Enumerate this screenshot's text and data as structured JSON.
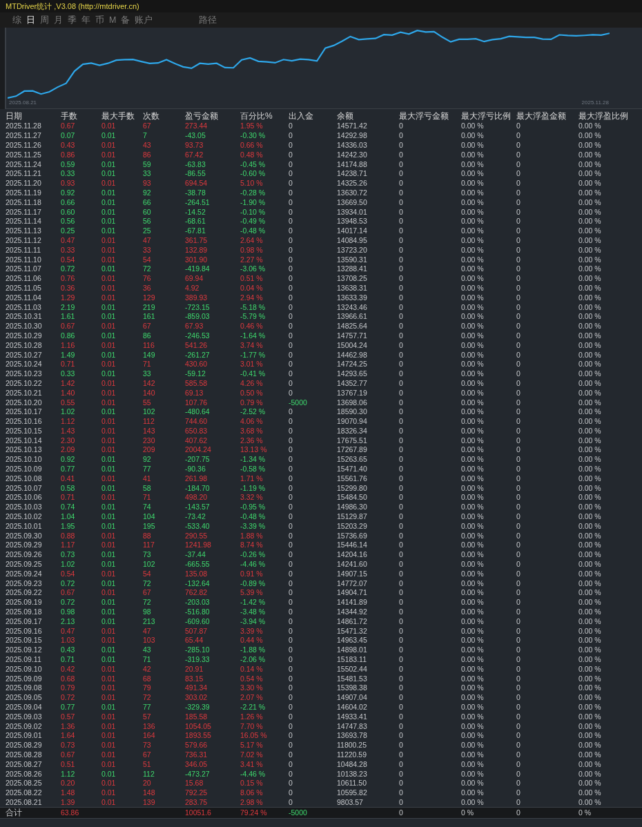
{
  "window": {
    "title": "MTDriver统计 ,V3.08 (http://mtdriver.cn)"
  },
  "tabs": [
    {
      "label": "综",
      "selected": false
    },
    {
      "label": "日",
      "selected": true
    },
    {
      "label": "周",
      "selected": false
    },
    {
      "label": "月",
      "selected": false
    },
    {
      "label": "季",
      "selected": false
    },
    {
      "label": "年",
      "selected": false
    },
    {
      "label": "币",
      "selected": false
    },
    {
      "label": "M",
      "selected": false
    },
    {
      "label": "备",
      "selected": false
    },
    {
      "label": "账户",
      "selected": false
    },
    {
      "label": "路径",
      "selected": false
    }
  ],
  "chart": {
    "start_label": "2025.08.21",
    "end_label": "2025.11.28"
  },
  "table": {
    "columns": [
      "日期",
      "手数",
      "最大手数",
      "次数",
      "盈亏金额",
      "百分比%",
      "出入金",
      "余额",
      "最大浮亏金额",
      "最大浮亏比例",
      "最大浮盈金额",
      "最大浮盈比例"
    ],
    "rows": [
      {
        "profit": true,
        "outflow": false,
        "cells": [
          "2025.11.28",
          "0.67",
          "0.01",
          "67",
          "273.44",
          "1.95 %",
          "0",
          "14571.42",
          "0",
          "0.00 %",
          "0",
          "0.00 %"
        ]
      },
      {
        "profit": false,
        "outflow": false,
        "cells": [
          "2025.11.27",
          "0.07",
          "0.01",
          "7",
          "-43.05",
          "-0.30 %",
          "0",
          "14292.98",
          "0",
          "0.00 %",
          "0",
          "0.00 %"
        ]
      },
      {
        "profit": true,
        "outflow": false,
        "cells": [
          "2025.11.26",
          "0.43",
          "0.01",
          "43",
          "93.73",
          "0.66 %",
          "0",
          "14336.03",
          "0",
          "0.00 %",
          "0",
          "0.00 %"
        ]
      },
      {
        "profit": true,
        "outflow": false,
        "cells": [
          "2025.11.25",
          "0.86",
          "0.01",
          "86",
          "67.42",
          "0.48 %",
          "0",
          "14242.30",
          "0",
          "0.00 %",
          "0",
          "0.00 %"
        ]
      },
      {
        "profit": false,
        "outflow": false,
        "cells": [
          "2025.11.24",
          "0.59",
          "0.01",
          "59",
          "-63.83",
          "-0.45 %",
          "0",
          "14174.88",
          "0",
          "0.00 %",
          "0",
          "0.00 %"
        ]
      },
      {
        "profit": false,
        "outflow": false,
        "cells": [
          "2025.11.21",
          "0.33",
          "0.01",
          "33",
          "-86.55",
          "-0.60 %",
          "0",
          "14238.71",
          "0",
          "0.00 %",
          "0",
          "0.00 %"
        ]
      },
      {
        "profit": true,
        "outflow": false,
        "cells": [
          "2025.11.20",
          "0.93",
          "0.01",
          "93",
          "694.54",
          "5.10 %",
          "0",
          "14325.26",
          "0",
          "0.00 %",
          "0",
          "0.00 %"
        ]
      },
      {
        "profit": false,
        "outflow": false,
        "cells": [
          "2025.11.19",
          "0.92",
          "0.01",
          "92",
          "-38.78",
          "-0.28 %",
          "0",
          "13630.72",
          "0",
          "0.00 %",
          "0",
          "0.00 %"
        ]
      },
      {
        "profit": false,
        "outflow": false,
        "cells": [
          "2025.11.18",
          "0.66",
          "0.01",
          "66",
          "-264.51",
          "-1.90 %",
          "0",
          "13669.50",
          "0",
          "0.00 %",
          "0",
          "0.00 %"
        ]
      },
      {
        "profit": false,
        "outflow": false,
        "cells": [
          "2025.11.17",
          "0.60",
          "0.01",
          "60",
          "-14.52",
          "-0.10 %",
          "0",
          "13934.01",
          "0",
          "0.00 %",
          "0",
          "0.00 %"
        ]
      },
      {
        "profit": false,
        "outflow": false,
        "cells": [
          "2025.11.14",
          "0.56",
          "0.01",
          "56",
          "-68.61",
          "-0.49 %",
          "0",
          "13948.53",
          "0",
          "0.00 %",
          "0",
          "0.00 %"
        ]
      },
      {
        "profit": false,
        "outflow": false,
        "cells": [
          "2025.11.13",
          "0.25",
          "0.01",
          "25",
          "-67.81",
          "-0.48 %",
          "0",
          "14017.14",
          "0",
          "0.00 %",
          "0",
          "0.00 %"
        ]
      },
      {
        "profit": true,
        "outflow": false,
        "cells": [
          "2025.11.12",
          "0.47",
          "0.01",
          "47",
          "361.75",
          "2.64 %",
          "0",
          "14084.95",
          "0",
          "0.00 %",
          "0",
          "0.00 %"
        ]
      },
      {
        "profit": true,
        "outflow": false,
        "cells": [
          "2025.11.11",
          "0.33",
          "0.01",
          "33",
          "132.89",
          "0.98 %",
          "0",
          "13723.20",
          "0",
          "0.00 %",
          "0",
          "0.00 %"
        ]
      },
      {
        "profit": true,
        "outflow": false,
        "cells": [
          "2025.11.10",
          "0.54",
          "0.01",
          "54",
          "301.90",
          "2.27 %",
          "0",
          "13590.31",
          "0",
          "0.00 %",
          "0",
          "0.00 %"
        ]
      },
      {
        "profit": false,
        "outflow": false,
        "cells": [
          "2025.11.07",
          "0.72",
          "0.01",
          "72",
          "-419.84",
          "-3.06 %",
          "0",
          "13288.41",
          "0",
          "0.00 %",
          "0",
          "0.00 %"
        ]
      },
      {
        "profit": true,
        "outflow": false,
        "cells": [
          "2025.11.06",
          "0.76",
          "0.01",
          "76",
          "69.94",
          "0.51 %",
          "0",
          "13708.25",
          "0",
          "0.00 %",
          "0",
          "0.00 %"
        ]
      },
      {
        "profit": true,
        "outflow": false,
        "cells": [
          "2025.11.05",
          "0.36",
          "0.01",
          "36",
          "4.92",
          "0.04 %",
          "0",
          "13638.31",
          "0",
          "0.00 %",
          "0",
          "0.00 %"
        ]
      },
      {
        "profit": true,
        "outflow": false,
        "cells": [
          "2025.11.04",
          "1.29",
          "0.01",
          "129",
          "389.93",
          "2.94 %",
          "0",
          "13633.39",
          "0",
          "0.00 %",
          "0",
          "0.00 %"
        ]
      },
      {
        "profit": false,
        "outflow": false,
        "cells": [
          "2025.11.03",
          "2.19",
          "0.01",
          "219",
          "-723.15",
          "-5.18 %",
          "0",
          "13243.46",
          "0",
          "0.00 %",
          "0",
          "0.00 %"
        ]
      },
      {
        "profit": false,
        "outflow": false,
        "cells": [
          "2025.10.31",
          "1.61",
          "0.01",
          "161",
          "-859.03",
          "-5.79 %",
          "0",
          "13966.61",
          "0",
          "0.00 %",
          "0",
          "0.00 %"
        ]
      },
      {
        "profit": true,
        "outflow": false,
        "cells": [
          "2025.10.30",
          "0.67",
          "0.01",
          "67",
          "67.93",
          "0.46 %",
          "0",
          "14825.64",
          "0",
          "0.00 %",
          "0",
          "0.00 %"
        ]
      },
      {
        "profit": false,
        "outflow": false,
        "cells": [
          "2025.10.29",
          "0.86",
          "0.01",
          "86",
          "-246.53",
          "-1.64 %",
          "0",
          "14757.71",
          "0",
          "0.00 %",
          "0",
          "0.00 %"
        ]
      },
      {
        "profit": true,
        "outflow": false,
        "cells": [
          "2025.10.28",
          "1.16",
          "0.01",
          "116",
          "541.26",
          "3.74 %",
          "0",
          "15004.24",
          "0",
          "0.00 %",
          "0",
          "0.00 %"
        ]
      },
      {
        "profit": false,
        "outflow": false,
        "cells": [
          "2025.10.27",
          "1.49",
          "0.01",
          "149",
          "-261.27",
          "-1.77 %",
          "0",
          "14462.98",
          "0",
          "0.00 %",
          "0",
          "0.00 %"
        ]
      },
      {
        "profit": true,
        "outflow": false,
        "cells": [
          "2025.10.24",
          "0.71",
          "0.01",
          "71",
          "430.60",
          "3.01 %",
          "0",
          "14724.25",
          "0",
          "0.00 %",
          "0",
          "0.00 %"
        ]
      },
      {
        "profit": false,
        "outflow": false,
        "cells": [
          "2025.10.23",
          "0.33",
          "0.01",
          "33",
          "-59.12",
          "-0.41 %",
          "0",
          "14293.65",
          "0",
          "0.00 %",
          "0",
          "0.00 %"
        ]
      },
      {
        "profit": true,
        "outflow": false,
        "cells": [
          "2025.10.22",
          "1.42",
          "0.01",
          "142",
          "585.58",
          "4.26 %",
          "0",
          "14352.77",
          "0",
          "0.00 %",
          "0",
          "0.00 %"
        ]
      },
      {
        "profit": true,
        "outflow": false,
        "cells": [
          "2025.10.21",
          "1.40",
          "0.01",
          "140",
          "69.13",
          "0.50 %",
          "0",
          "13767.19",
          "0",
          "0.00 %",
          "0",
          "0.00 %"
        ]
      },
      {
        "profit": true,
        "outflow": true,
        "cells": [
          "2025.10.20",
          "0.55",
          "0.01",
          "55",
          "107.76",
          "0.79 %",
          "-5000",
          "13698.06",
          "0",
          "0.00 %",
          "0",
          "0.00 %"
        ]
      },
      {
        "profit": false,
        "outflow": false,
        "cells": [
          "2025.10.17",
          "1.02",
          "0.01",
          "102",
          "-480.64",
          "-2.52 %",
          "0",
          "18590.30",
          "0",
          "0.00 %",
          "0",
          "0.00 %"
        ]
      },
      {
        "profit": true,
        "outflow": false,
        "cells": [
          "2025.10.16",
          "1.12",
          "0.01",
          "112",
          "744.60",
          "4.06 %",
          "0",
          "19070.94",
          "0",
          "0.00 %",
          "0",
          "0.00 %"
        ]
      },
      {
        "profit": true,
        "outflow": false,
        "cells": [
          "2025.10.15",
          "1.43",
          "0.01",
          "143",
          "650.83",
          "3.68 %",
          "0",
          "18326.34",
          "0",
          "0.00 %",
          "0",
          "0.00 %"
        ]
      },
      {
        "profit": true,
        "outflow": false,
        "cells": [
          "2025.10.14",
          "2.30",
          "0.01",
          "230",
          "407.62",
          "2.36 %",
          "0",
          "17675.51",
          "0",
          "0.00 %",
          "0",
          "0.00 %"
        ]
      },
      {
        "profit": true,
        "outflow": false,
        "cells": [
          "2025.10.13",
          "2.09",
          "0.01",
          "209",
          "2004.24",
          "13.13 %",
          "0",
          "17267.89",
          "0",
          "0.00 %",
          "0",
          "0.00 %"
        ]
      },
      {
        "profit": false,
        "outflow": false,
        "cells": [
          "2025.10.10",
          "0.92",
          "0.01",
          "92",
          "-207.75",
          "-1.34 %",
          "0",
          "15263.65",
          "0",
          "0.00 %",
          "0",
          "0.00 %"
        ]
      },
      {
        "profit": false,
        "outflow": false,
        "cells": [
          "2025.10.09",
          "0.77",
          "0.01",
          "77",
          "-90.36",
          "-0.58 %",
          "0",
          "15471.40",
          "0",
          "0.00 %",
          "0",
          "0.00 %"
        ]
      },
      {
        "profit": true,
        "outflow": false,
        "cells": [
          "2025.10.08",
          "0.41",
          "0.01",
          "41",
          "261.98",
          "1.71 %",
          "0",
          "15561.76",
          "0",
          "0.00 %",
          "0",
          "0.00 %"
        ]
      },
      {
        "profit": false,
        "outflow": false,
        "cells": [
          "2025.10.07",
          "0.58",
          "0.01",
          "58",
          "-184.70",
          "-1.19 %",
          "0",
          "15299.80",
          "0",
          "0.00 %",
          "0",
          "0.00 %"
        ]
      },
      {
        "profit": true,
        "outflow": false,
        "cells": [
          "2025.10.06",
          "0.71",
          "0.01",
          "71",
          "498.20",
          "3.32 %",
          "0",
          "15484.50",
          "0",
          "0.00 %",
          "0",
          "0.00 %"
        ]
      },
      {
        "profit": false,
        "outflow": false,
        "cells": [
          "2025.10.03",
          "0.74",
          "0.01",
          "74",
          "-143.57",
          "-0.95 %",
          "0",
          "14986.30",
          "0",
          "0.00 %",
          "0",
          "0.00 %"
        ]
      },
      {
        "profit": false,
        "outflow": false,
        "cells": [
          "2025.10.02",
          "1.04",
          "0.01",
          "104",
          "-73.42",
          "-0.48 %",
          "0",
          "15129.87",
          "0",
          "0.00 %",
          "0",
          "0.00 %"
        ]
      },
      {
        "profit": false,
        "outflow": false,
        "cells": [
          "2025.10.01",
          "1.95",
          "0.01",
          "195",
          "-533.40",
          "-3.39 %",
          "0",
          "15203.29",
          "0",
          "0.00 %",
          "0",
          "0.00 %"
        ]
      },
      {
        "profit": true,
        "outflow": false,
        "cells": [
          "2025.09.30",
          "0.88",
          "0.01",
          "88",
          "290.55",
          "1.88 %",
          "0",
          "15736.69",
          "0",
          "0.00 %",
          "0",
          "0.00 %"
        ]
      },
      {
        "profit": true,
        "outflow": false,
        "cells": [
          "2025.09.29",
          "1.17",
          "0.01",
          "117",
          "1241.98",
          "8.74 %",
          "0",
          "15446.14",
          "0",
          "0.00 %",
          "0",
          "0.00 %"
        ]
      },
      {
        "profit": false,
        "outflow": false,
        "cells": [
          "2025.09.26",
          "0.73",
          "0.01",
          "73",
          "-37.44",
          "-0.26 %",
          "0",
          "14204.16",
          "0",
          "0.00 %",
          "0",
          "0.00 %"
        ]
      },
      {
        "profit": false,
        "outflow": false,
        "cells": [
          "2025.09.25",
          "1.02",
          "0.01",
          "102",
          "-665.55",
          "-4.46 %",
          "0",
          "14241.60",
          "0",
          "0.00 %",
          "0",
          "0.00 %"
        ]
      },
      {
        "profit": true,
        "outflow": false,
        "cells": [
          "2025.09.24",
          "0.54",
          "0.01",
          "54",
          "135.08",
          "0.91 %",
          "0",
          "14907.15",
          "0",
          "0.00 %",
          "0",
          "0.00 %"
        ]
      },
      {
        "profit": false,
        "outflow": false,
        "cells": [
          "2025.09.23",
          "0.72",
          "0.01",
          "72",
          "-132.64",
          "-0.89 %",
          "0",
          "14772.07",
          "0",
          "0.00 %",
          "0",
          "0.00 %"
        ]
      },
      {
        "profit": true,
        "outflow": false,
        "cells": [
          "2025.09.22",
          "0.67",
          "0.01",
          "67",
          "762.82",
          "5.39 %",
          "0",
          "14904.71",
          "0",
          "0.00 %",
          "0",
          "0.00 %"
        ]
      },
      {
        "profit": false,
        "outflow": false,
        "cells": [
          "2025.09.19",
          "0.72",
          "0.01",
          "72",
          "-203.03",
          "-1.42 %",
          "0",
          "14141.89",
          "0",
          "0.00 %",
          "0",
          "0.00 %"
        ]
      },
      {
        "profit": false,
        "outflow": false,
        "cells": [
          "2025.09.18",
          "0.98",
          "0.01",
          "98",
          "-516.80",
          "-3.48 %",
          "0",
          "14344.92",
          "0",
          "0.00 %",
          "0",
          "0.00 %"
        ]
      },
      {
        "profit": false,
        "outflow": false,
        "cells": [
          "2025.09.17",
          "2.13",
          "0.01",
          "213",
          "-609.60",
          "-3.94 %",
          "0",
          "14861.72",
          "0",
          "0.00 %",
          "0",
          "0.00 %"
        ]
      },
      {
        "profit": true,
        "outflow": false,
        "cells": [
          "2025.09.16",
          "0.47",
          "0.01",
          "47",
          "507.87",
          "3.39 %",
          "0",
          "15471.32",
          "0",
          "0.00 %",
          "0",
          "0.00 %"
        ]
      },
      {
        "profit": true,
        "outflow": false,
        "cells": [
          "2025.09.15",
          "1.03",
          "0.01",
          "103",
          "65.44",
          "0.44 %",
          "0",
          "14963.45",
          "0",
          "0.00 %",
          "0",
          "0.00 %"
        ]
      },
      {
        "profit": false,
        "outflow": false,
        "cells": [
          "2025.09.12",
          "0.43",
          "0.01",
          "43",
          "-285.10",
          "-1.88 %",
          "0",
          "14898.01",
          "0",
          "0.00 %",
          "0",
          "0.00 %"
        ]
      },
      {
        "profit": false,
        "outflow": false,
        "cells": [
          "2025.09.11",
          "0.71",
          "0.01",
          "71",
          "-319.33",
          "-2.06 %",
          "0",
          "15183.11",
          "0",
          "0.00 %",
          "0",
          "0.00 %"
        ]
      },
      {
        "profit": true,
        "outflow": false,
        "cells": [
          "2025.09.10",
          "0.42",
          "0.01",
          "42",
          "20.91",
          "0.14 %",
          "0",
          "15502.44",
          "0",
          "0.00 %",
          "0",
          "0.00 %"
        ]
      },
      {
        "profit": true,
        "outflow": false,
        "cells": [
          "2025.09.09",
          "0.68",
          "0.01",
          "68",
          "83.15",
          "0.54 %",
          "0",
          "15481.53",
          "0",
          "0.00 %",
          "0",
          "0.00 %"
        ]
      },
      {
        "profit": true,
        "outflow": false,
        "cells": [
          "2025.09.08",
          "0.79",
          "0.01",
          "79",
          "491.34",
          "3.30 %",
          "0",
          "15398.38",
          "0",
          "0.00 %",
          "0",
          "0.00 %"
        ]
      },
      {
        "profit": true,
        "outflow": false,
        "cells": [
          "2025.09.05",
          "0.72",
          "0.01",
          "72",
          "303.02",
          "2.07 %",
          "0",
          "14907.04",
          "0",
          "0.00 %",
          "0",
          "0.00 %"
        ]
      },
      {
        "profit": false,
        "outflow": false,
        "cells": [
          "2025.09.04",
          "0.77",
          "0.01",
          "77",
          "-329.39",
          "-2.21 %",
          "0",
          "14604.02",
          "0",
          "0.00 %",
          "0",
          "0.00 %"
        ]
      },
      {
        "profit": true,
        "outflow": false,
        "cells": [
          "2025.09.03",
          "0.57",
          "0.01",
          "57",
          "185.58",
          "1.26 %",
          "0",
          "14933.41",
          "0",
          "0.00 %",
          "0",
          "0.00 %"
        ]
      },
      {
        "profit": true,
        "outflow": false,
        "cells": [
          "2025.09.02",
          "1.36",
          "0.01",
          "136",
          "1054.05",
          "7.70 %",
          "0",
          "14747.83",
          "0",
          "0.00 %",
          "0",
          "0.00 %"
        ]
      },
      {
        "profit": true,
        "outflow": false,
        "cells": [
          "2025.09.01",
          "1.64",
          "0.01",
          "164",
          "1893.55",
          "16.05 %",
          "0",
          "13693.78",
          "0",
          "0.00 %",
          "0",
          "0.00 %"
        ]
      },
      {
        "profit": true,
        "outflow": false,
        "cells": [
          "2025.08.29",
          "0.73",
          "0.01",
          "73",
          "579.66",
          "5.17 %",
          "0",
          "11800.25",
          "0",
          "0.00 %",
          "0",
          "0.00 %"
        ]
      },
      {
        "profit": true,
        "outflow": false,
        "cells": [
          "2025.08.28",
          "0.67",
          "0.01",
          "67",
          "736.31",
          "7.02 %",
          "0",
          "11220.59",
          "0",
          "0.00 %",
          "0",
          "0.00 %"
        ]
      },
      {
        "profit": true,
        "outflow": false,
        "cells": [
          "2025.08.27",
          "0.51",
          "0.01",
          "51",
          "346.05",
          "3.41 %",
          "0",
          "10484.28",
          "0",
          "0.00 %",
          "0",
          "0.00 %"
        ]
      },
      {
        "profit": false,
        "outflow": false,
        "cells": [
          "2025.08.26",
          "1.12",
          "0.01",
          "112",
          "-473.27",
          "-4.46 %",
          "0",
          "10138.23",
          "0",
          "0.00 %",
          "0",
          "0.00 %"
        ]
      },
      {
        "profit": true,
        "outflow": false,
        "cells": [
          "2025.08.25",
          "0.20",
          "0.01",
          "20",
          "15.68",
          "0.15 %",
          "0",
          "10611.50",
          "0",
          "0.00 %",
          "0",
          "0.00 %"
        ]
      },
      {
        "profit": true,
        "outflow": false,
        "cells": [
          "2025.08.22",
          "1.48",
          "0.01",
          "148",
          "792.25",
          "8.06 %",
          "0",
          "10595.82",
          "0",
          "0.00 %",
          "0",
          "0.00 %"
        ]
      },
      {
        "profit": true,
        "outflow": false,
        "cells": [
          "2025.08.21",
          "1.39",
          "0.01",
          "139",
          "283.75",
          "2.98 %",
          "0",
          "9803.57",
          "0",
          "0.00 %",
          "0",
          "0.00 %"
        ]
      }
    ],
    "total": {
      "profit": true,
      "outflow": true,
      "cells": [
        "合计",
        "63.86",
        null,
        null,
        "10051.6",
        "79.24 %",
        "-5000",
        null,
        "0",
        "0 %",
        "0",
        "0 %"
      ]
    }
  }
}
